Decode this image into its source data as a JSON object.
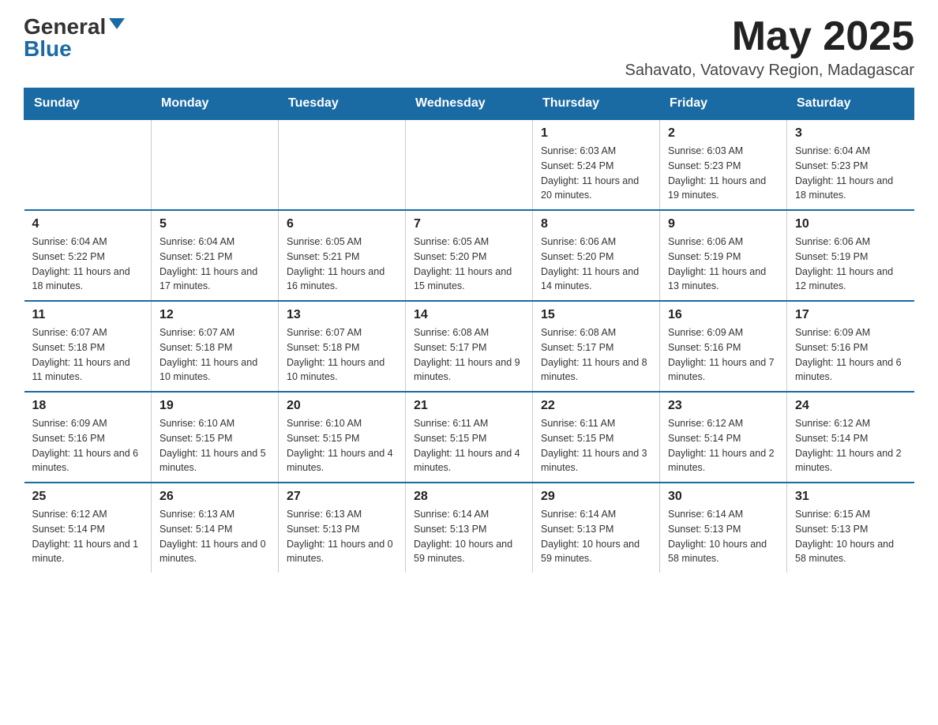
{
  "logo": {
    "general": "General",
    "blue": "Blue"
  },
  "title": "May 2025",
  "location": "Sahavato, Vatovavy Region, Madagascar",
  "weekdays": [
    "Sunday",
    "Monday",
    "Tuesday",
    "Wednesday",
    "Thursday",
    "Friday",
    "Saturday"
  ],
  "weeks": [
    [
      {
        "day": "",
        "info": ""
      },
      {
        "day": "",
        "info": ""
      },
      {
        "day": "",
        "info": ""
      },
      {
        "day": "",
        "info": ""
      },
      {
        "day": "1",
        "info": "Sunrise: 6:03 AM\nSunset: 5:24 PM\nDaylight: 11 hours and 20 minutes."
      },
      {
        "day": "2",
        "info": "Sunrise: 6:03 AM\nSunset: 5:23 PM\nDaylight: 11 hours and 19 minutes."
      },
      {
        "day": "3",
        "info": "Sunrise: 6:04 AM\nSunset: 5:23 PM\nDaylight: 11 hours and 18 minutes."
      }
    ],
    [
      {
        "day": "4",
        "info": "Sunrise: 6:04 AM\nSunset: 5:22 PM\nDaylight: 11 hours and 18 minutes."
      },
      {
        "day": "5",
        "info": "Sunrise: 6:04 AM\nSunset: 5:21 PM\nDaylight: 11 hours and 17 minutes."
      },
      {
        "day": "6",
        "info": "Sunrise: 6:05 AM\nSunset: 5:21 PM\nDaylight: 11 hours and 16 minutes."
      },
      {
        "day": "7",
        "info": "Sunrise: 6:05 AM\nSunset: 5:20 PM\nDaylight: 11 hours and 15 minutes."
      },
      {
        "day": "8",
        "info": "Sunrise: 6:06 AM\nSunset: 5:20 PM\nDaylight: 11 hours and 14 minutes."
      },
      {
        "day": "9",
        "info": "Sunrise: 6:06 AM\nSunset: 5:19 PM\nDaylight: 11 hours and 13 minutes."
      },
      {
        "day": "10",
        "info": "Sunrise: 6:06 AM\nSunset: 5:19 PM\nDaylight: 11 hours and 12 minutes."
      }
    ],
    [
      {
        "day": "11",
        "info": "Sunrise: 6:07 AM\nSunset: 5:18 PM\nDaylight: 11 hours and 11 minutes."
      },
      {
        "day": "12",
        "info": "Sunrise: 6:07 AM\nSunset: 5:18 PM\nDaylight: 11 hours and 10 minutes."
      },
      {
        "day": "13",
        "info": "Sunrise: 6:07 AM\nSunset: 5:18 PM\nDaylight: 11 hours and 10 minutes."
      },
      {
        "day": "14",
        "info": "Sunrise: 6:08 AM\nSunset: 5:17 PM\nDaylight: 11 hours and 9 minutes."
      },
      {
        "day": "15",
        "info": "Sunrise: 6:08 AM\nSunset: 5:17 PM\nDaylight: 11 hours and 8 minutes."
      },
      {
        "day": "16",
        "info": "Sunrise: 6:09 AM\nSunset: 5:16 PM\nDaylight: 11 hours and 7 minutes."
      },
      {
        "day": "17",
        "info": "Sunrise: 6:09 AM\nSunset: 5:16 PM\nDaylight: 11 hours and 6 minutes."
      }
    ],
    [
      {
        "day": "18",
        "info": "Sunrise: 6:09 AM\nSunset: 5:16 PM\nDaylight: 11 hours and 6 minutes."
      },
      {
        "day": "19",
        "info": "Sunrise: 6:10 AM\nSunset: 5:15 PM\nDaylight: 11 hours and 5 minutes."
      },
      {
        "day": "20",
        "info": "Sunrise: 6:10 AM\nSunset: 5:15 PM\nDaylight: 11 hours and 4 minutes."
      },
      {
        "day": "21",
        "info": "Sunrise: 6:11 AM\nSunset: 5:15 PM\nDaylight: 11 hours and 4 minutes."
      },
      {
        "day": "22",
        "info": "Sunrise: 6:11 AM\nSunset: 5:15 PM\nDaylight: 11 hours and 3 minutes."
      },
      {
        "day": "23",
        "info": "Sunrise: 6:12 AM\nSunset: 5:14 PM\nDaylight: 11 hours and 2 minutes."
      },
      {
        "day": "24",
        "info": "Sunrise: 6:12 AM\nSunset: 5:14 PM\nDaylight: 11 hours and 2 minutes."
      }
    ],
    [
      {
        "day": "25",
        "info": "Sunrise: 6:12 AM\nSunset: 5:14 PM\nDaylight: 11 hours and 1 minute."
      },
      {
        "day": "26",
        "info": "Sunrise: 6:13 AM\nSunset: 5:14 PM\nDaylight: 11 hours and 0 minutes."
      },
      {
        "day": "27",
        "info": "Sunrise: 6:13 AM\nSunset: 5:13 PM\nDaylight: 11 hours and 0 minutes."
      },
      {
        "day": "28",
        "info": "Sunrise: 6:14 AM\nSunset: 5:13 PM\nDaylight: 10 hours and 59 minutes."
      },
      {
        "day": "29",
        "info": "Sunrise: 6:14 AM\nSunset: 5:13 PM\nDaylight: 10 hours and 59 minutes."
      },
      {
        "day": "30",
        "info": "Sunrise: 6:14 AM\nSunset: 5:13 PM\nDaylight: 10 hours and 58 minutes."
      },
      {
        "day": "31",
        "info": "Sunrise: 6:15 AM\nSunset: 5:13 PM\nDaylight: 10 hours and 58 minutes."
      }
    ]
  ]
}
